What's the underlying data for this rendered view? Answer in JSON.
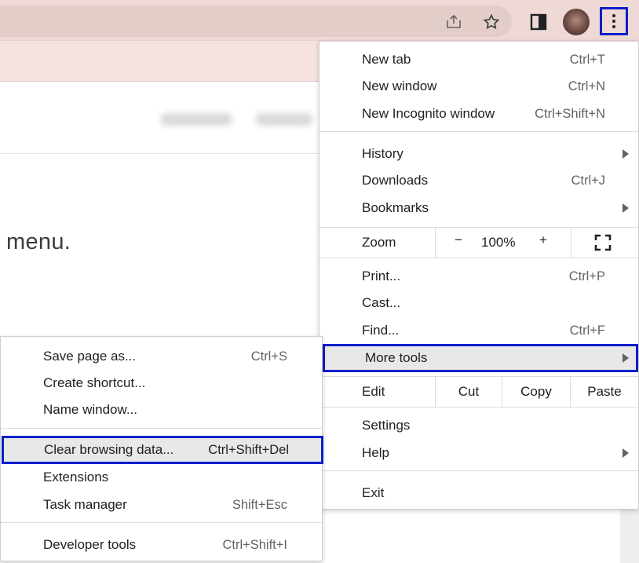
{
  "toolbar": {
    "icons": [
      "share-icon",
      "star-icon",
      "side-panel-icon",
      "avatar",
      "more-vert-icon"
    ]
  },
  "page": {
    "text": "menu."
  },
  "main_menu": {
    "new_tab": {
      "label": "New tab",
      "shortcut": "Ctrl+T"
    },
    "new_window": {
      "label": "New window",
      "shortcut": "Ctrl+N"
    },
    "new_incognito": {
      "label": "New Incognito window",
      "shortcut": "Ctrl+Shift+N"
    },
    "history": {
      "label": "History"
    },
    "downloads": {
      "label": "Downloads",
      "shortcut": "Ctrl+J"
    },
    "bookmarks": {
      "label": "Bookmarks"
    },
    "zoom": {
      "label": "Zoom",
      "minus": "−",
      "value": "100%",
      "plus": "+"
    },
    "print": {
      "label": "Print...",
      "shortcut": "Ctrl+P"
    },
    "cast": {
      "label": "Cast..."
    },
    "find": {
      "label": "Find...",
      "shortcut": "Ctrl+F"
    },
    "more_tools": {
      "label": "More tools"
    },
    "edit": {
      "label": "Edit",
      "cut": "Cut",
      "copy": "Copy",
      "paste": "Paste"
    },
    "settings": {
      "label": "Settings"
    },
    "help": {
      "label": "Help"
    },
    "exit": {
      "label": "Exit"
    }
  },
  "sub_menu": {
    "save_page": {
      "label": "Save page as...",
      "shortcut": "Ctrl+S"
    },
    "create_shortcut": {
      "label": "Create shortcut..."
    },
    "name_window": {
      "label": "Name window..."
    },
    "clear_browsing": {
      "label": "Clear browsing data...",
      "shortcut": "Ctrl+Shift+Del"
    },
    "extensions": {
      "label": "Extensions"
    },
    "task_manager": {
      "label": "Task manager",
      "shortcut": "Shift+Esc"
    },
    "developer_tools": {
      "label": "Developer tools",
      "shortcut": "Ctrl+Shift+I"
    }
  },
  "colors": {
    "highlight_border": "#0a1fc9",
    "toolbar_bg": "#efd9d6",
    "hover_bg": "#e8e8e8"
  }
}
